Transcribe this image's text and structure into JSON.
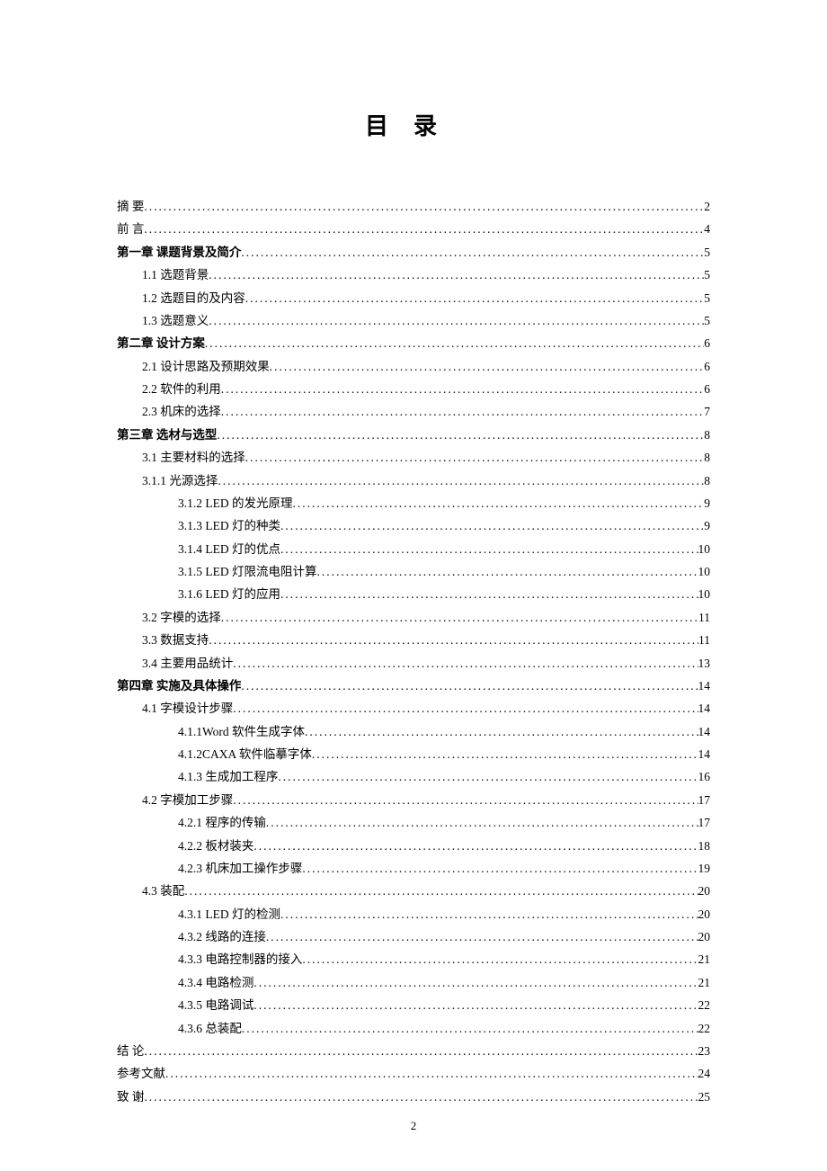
{
  "title": "目录",
  "page_number": "2",
  "entries": [
    {
      "label": "摘  要",
      "page": "2",
      "indent": 0,
      "bold": false,
      "spaced": false
    },
    {
      "label": "前  言",
      "page": "4",
      "indent": 0,
      "bold": false,
      "spaced": false
    },
    {
      "label": "第一章 课题背景及简介",
      "page": "5",
      "indent": 0,
      "bold": true,
      "spaced": false
    },
    {
      "label": "1.1 选题背景",
      "page": "5",
      "indent": 1,
      "bold": false,
      "spaced": false
    },
    {
      "label": "1.2 选题目的及内容",
      "page": "5",
      "indent": 1,
      "bold": false,
      "spaced": false
    },
    {
      "label": "1.3 选题意义",
      "page": "5",
      "indent": 1,
      "bold": false,
      "spaced": false
    },
    {
      "label": "第二章 设计方案",
      "page": "6",
      "indent": 0,
      "bold": true,
      "spaced": false
    },
    {
      "label": "2.1 设计思路及预期效果",
      "page": "6",
      "indent": 1,
      "bold": false,
      "spaced": false
    },
    {
      "label": "2.2 软件的利用",
      "page": "6",
      "indent": 1,
      "bold": false,
      "spaced": false
    },
    {
      "label": "2.3 机床的选择",
      "page": "7",
      "indent": 1,
      "bold": false,
      "spaced": false
    },
    {
      "label": "第三章 选材与选型",
      "page": "8",
      "indent": 0,
      "bold": true,
      "spaced": false
    },
    {
      "label": "3.1 主要材料的选择",
      "page": "8",
      "indent": 1,
      "bold": false,
      "spaced": false
    },
    {
      "label": "3.1.1 光源选择",
      "page": "8",
      "indent": 1,
      "bold": false,
      "spaced": false
    },
    {
      "label": "3.1.2 LED 的发光原理",
      "page": "9",
      "indent": 2,
      "bold": false,
      "spaced": false
    },
    {
      "label": "3.1.3 LED 灯的种类",
      "page": "9",
      "indent": 2,
      "bold": false,
      "spaced": false
    },
    {
      "label": "3.1.4 LED 灯的优点",
      "page": "10",
      "indent": 2,
      "bold": false,
      "spaced": false
    },
    {
      "label": "3.1.5 LED 灯限流电阻计算",
      "page": "10",
      "indent": 2,
      "bold": false,
      "spaced": false
    },
    {
      "label": "3.1.6 LED 灯的应用",
      "page": "10",
      "indent": 2,
      "bold": false,
      "spaced": false
    },
    {
      "label": "3.2 字模的选择",
      "page": "11",
      "indent": 1,
      "bold": false,
      "spaced": false
    },
    {
      "label": "3.3 数据支持",
      "page": "11",
      "indent": 1,
      "bold": false,
      "spaced": false
    },
    {
      "label": "3.4 主要用品统计",
      "page": "13",
      "indent": 1,
      "bold": false,
      "spaced": false
    },
    {
      "label": "第四章 实施及具体操作",
      "page": "14",
      "indent": 0,
      "bold": true,
      "spaced": false
    },
    {
      "label": "4.1 字模设计步骤",
      "page": "14",
      "indent": 1,
      "bold": false,
      "spaced": false
    },
    {
      "label": "4.1.1Word 软件生成字体",
      "page": "14",
      "indent": 2,
      "bold": false,
      "spaced": false
    },
    {
      "label": "4.1.2CAXA 软件临摹字体",
      "page": "14",
      "indent": 2,
      "bold": false,
      "spaced": false
    },
    {
      "label": "4.1.3 生成加工程序",
      "page": "16",
      "indent": 2,
      "bold": false,
      "spaced": false
    },
    {
      "label": "4.2 字模加工步骤",
      "page": "17",
      "indent": 1,
      "bold": false,
      "spaced": false
    },
    {
      "label": "4.2.1 程序的传输",
      "page": "17",
      "indent": 2,
      "bold": false,
      "spaced": false
    },
    {
      "label": "4.2.2 板材装夹",
      "page": "18",
      "indent": 2,
      "bold": false,
      "spaced": false
    },
    {
      "label": "4.2.3 机床加工操作步骤",
      "page": "19",
      "indent": 2,
      "bold": false,
      "spaced": false
    },
    {
      "label": "4.3 装配",
      "page": "20",
      "indent": 1,
      "bold": false,
      "spaced": false
    },
    {
      "label": "4.3.1 LED 灯的检测",
      "page": "20",
      "indent": 2,
      "bold": false,
      "spaced": false
    },
    {
      "label": "4.3.2 线路的连接",
      "page": "20",
      "indent": 2,
      "bold": false,
      "spaced": false
    },
    {
      "label": "4.3.3 电路控制器的接入",
      "page": "21",
      "indent": 2,
      "bold": false,
      "spaced": false
    },
    {
      "label": "4.3.4 电路检测",
      "page": "21",
      "indent": 2,
      "bold": false,
      "spaced": false
    },
    {
      "label": "4.3.5 电路调试",
      "page": "22",
      "indent": 2,
      "bold": false,
      "spaced": false
    },
    {
      "label": "4.3.6 总装配",
      "page": "22",
      "indent": 2,
      "bold": false,
      "spaced": false
    },
    {
      "label": "结  论",
      "page": "23",
      "indent": 0,
      "bold": false,
      "spaced": false
    },
    {
      "label": "参考文献",
      "page": "24",
      "indent": 0,
      "bold": false,
      "spaced": false
    },
    {
      "label": "致  谢",
      "page": "25",
      "indent": 0,
      "bold": false,
      "spaced": false
    }
  ]
}
